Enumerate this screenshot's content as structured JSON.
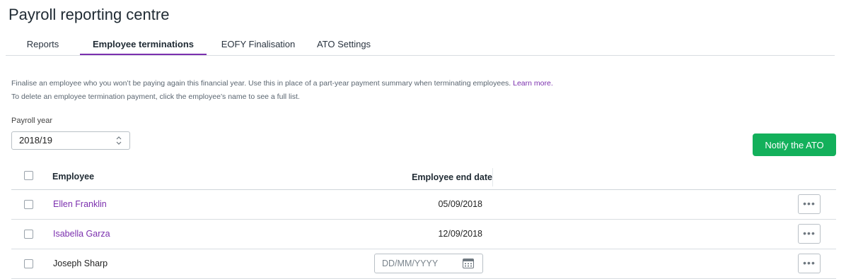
{
  "page": {
    "title": "Payroll reporting centre"
  },
  "tabs": [
    {
      "label": "Reports",
      "active": false
    },
    {
      "label": "Employee terminations",
      "active": true
    },
    {
      "label": "EOFY Finalisation",
      "active": false
    },
    {
      "label": "ATO Settings",
      "active": false
    }
  ],
  "description": {
    "line1": "Finalise an employee who you won’t be paying again this financial year. Use this in place of a part-year payment summary when terminating employees. ",
    "learn_more": "Learn more.",
    "line2": "To delete an employee termination payment, click the employee’s name to see a full list."
  },
  "payroll_year": {
    "label": "Payroll year",
    "value": "2018/19"
  },
  "actions": {
    "notify_ato": "Notify the ATO"
  },
  "table": {
    "headers": {
      "employee": "Employee",
      "end_date": "Employee end date"
    },
    "rows": [
      {
        "name": "Ellen Franklin",
        "end_date": "05/09/2018",
        "is_link": true
      },
      {
        "name": "Isabella Garza",
        "end_date": "12/09/2018",
        "is_link": true
      },
      {
        "name": "Joseph Sharp",
        "end_date": "",
        "date_placeholder": "DD/MM/YYYY",
        "is_link": false
      }
    ],
    "more_label": "•••"
  },
  "colors": {
    "accent": "#7b2fae",
    "primary_button": "#13b05b",
    "border": "#d8dde1"
  },
  "icons": {
    "select": "up-down-chevron-icon",
    "calendar": "calendar-icon",
    "more": "ellipsis-icon"
  }
}
